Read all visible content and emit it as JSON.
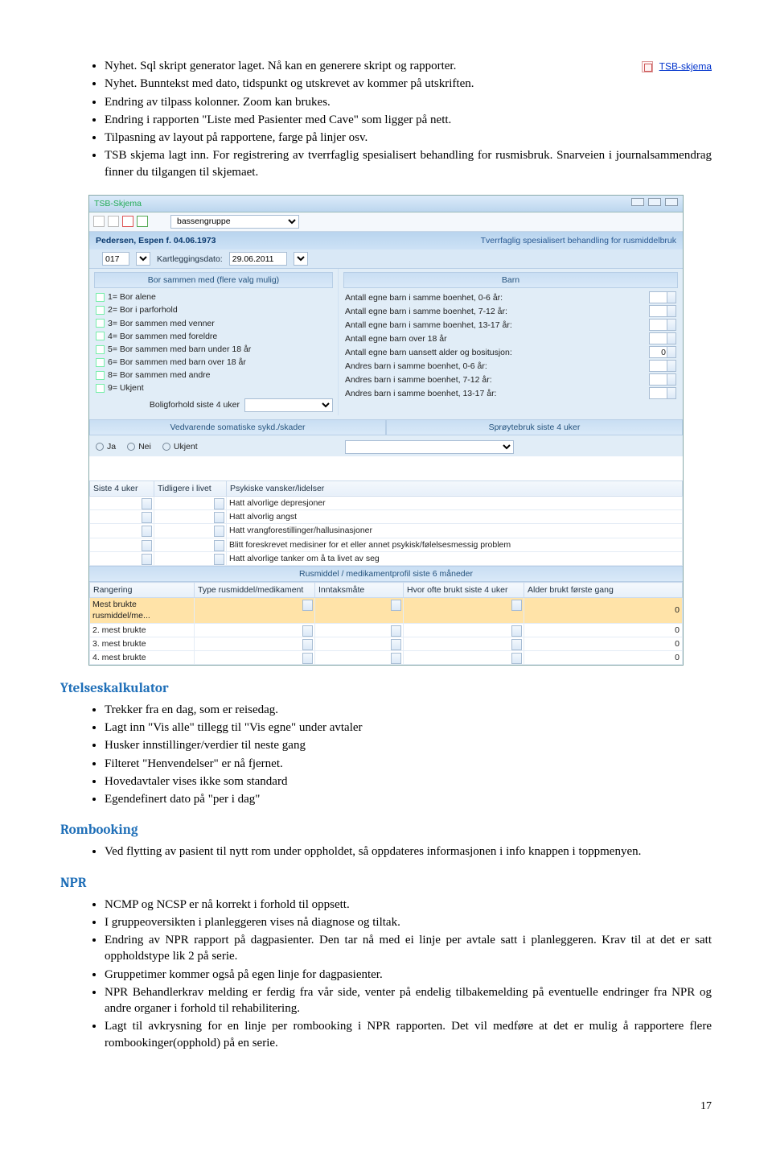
{
  "top_list": [
    "Nyhet. Sql skript generator laget. Nå kan en generere skript og rapporter.",
    "Nyhet. Bunntekst med dato, tidspunkt og utskrevet av kommer på utskriften.",
    "Endring av tilpass kolonner. Zoom kan brukes.",
    "Endring i rapporten \"Liste med Pasienter med Cave\" som ligger på nett.",
    "Tilpasning av layout på rapportene, farge på linjer osv.",
    "TSB skjema lagt inn. For registrering av tverrfaglig spesialisert behandling for rusmisbruk. Snarveien i journalsammendrag finner du tilgangen til skjemaet."
  ],
  "tsb_link": "TSB-skjema",
  "screenshot": {
    "window_title": "TSB-Skjema",
    "toolbar_group": "bassengruppe",
    "patient": "Pedersen, Espen f. 04.06.1973",
    "banner_right": "Tverrfaglig spesialisert behandling for rusmiddelbruk",
    "id": "017",
    "kart_label": "Kartleggingsdato:",
    "kart_date": "29.06.2011",
    "band_left": "Bor sammen med (flere valg mulig)",
    "band_right": "Barn",
    "left_opts": [
      "1= Bor alene",
      "2= Bor i parforhold",
      "3= Bor sammen med venner",
      "4= Bor sammen med foreldre",
      "5= Bor sammen med barn under 18 år",
      "6= Bor sammen med barn over 18 år",
      "8= Bor sammen med andre",
      "9= Ukjent"
    ],
    "bolig_label": "Boligforhold siste 4 uker",
    "right_rows": [
      "Antall egne barn i samme boenhet, 0-6 år:",
      "Antall egne barn i samme boenhet, 7-12 år:",
      "Antall egne barn i samme boenhet, 13-17 år:",
      "Antall egne barn over 18 år",
      "Antall egne barn uansett alder og bositusjon:",
      "Andres barn i samme boenhet, 0-6 år:",
      "Andres barn i samme boenhet, 7-12 år:",
      "Andres barn i samme boenhet, 13-17 år:"
    ],
    "right_zero_at": 4,
    "band2_left": "Vedvarende somatiske sykd./skader",
    "band2_right": "Sprøytebruk siste 4 uker",
    "radio_labels": [
      "Ja",
      "Nei",
      "Ukjent"
    ],
    "tbl1_headers": [
      "Siste 4 uker",
      "Tidligere i livet",
      "Psykiske vansker/lidelser"
    ],
    "tbl1_rows": [
      "Hatt alvorlige depresjoner",
      "Hatt alvorlig angst",
      "Hatt vrangforestillinger/hallusinasjoner",
      "Blitt foreskrevet medisiner for et eller annet psykisk/følelsesmessig problem",
      "Hatt alvorlige tanker om å ta livet av seg"
    ],
    "midband": "Rusmiddel / medikamentprofil siste 6 måneder",
    "tbl2_headers": [
      "Rangering",
      "Type rusmiddel/medikament",
      "Inntaksmåte",
      "Hvor ofte brukt siste 4 uker",
      "Alder brukt første gang"
    ],
    "tbl2_rows": [
      {
        "label": "Mest brukte rusmiddel/me...",
        "age": "0",
        "hl": true
      },
      {
        "label": "2. mest brukte",
        "age": "0",
        "hl": false
      },
      {
        "label": "3. mest brukte",
        "age": "0",
        "hl": false
      },
      {
        "label": "4. mest brukte",
        "age": "0",
        "hl": false
      }
    ]
  },
  "section_ytelses": "Ytelseskalkulator",
  "ytelses_list": [
    "Trekker fra en dag, som er reisedag.",
    "Lagt inn \"Vis alle\" tillegg til \"Vis egne\" under avtaler",
    "Husker innstillinger/verdier til neste gang",
    "Filteret \"Henvendelser\" er nå fjernet.",
    "Hovedavtaler vises ikke som standard",
    "Egendefinert dato på \"per i dag\""
  ],
  "section_rom": "Rombooking",
  "rom_list": [
    "Ved flytting av pasient til nytt rom under oppholdet, så oppdateres informasjonen i info knappen i toppmenyen."
  ],
  "section_npr": "NPR",
  "npr_list": [
    "NCMP og NCSP er nå korrekt i forhold til oppsett.",
    "I gruppeoversikten i planleggeren vises nå diagnose og tiltak.",
    "Endring av NPR rapport på dagpasienter. Den tar nå med ei linje per avtale satt i planleggeren. Krav til at det er satt oppholdstype lik 2 på serie.",
    "Gruppetimer kommer også på egen linje for dagpasienter.",
    "NPR Behandlerkrav melding er ferdig fra vår side, venter på endelig tilbakemelding på eventuelle endringer fra NPR og andre organer i forhold til rehabilitering.",
    "Lagt til avkrysning for en linje per rombooking i NPR rapporten. Det vil medføre at det er mulig å rapportere flere rombookinger(opphold) på en serie."
  ],
  "page_number": "17"
}
